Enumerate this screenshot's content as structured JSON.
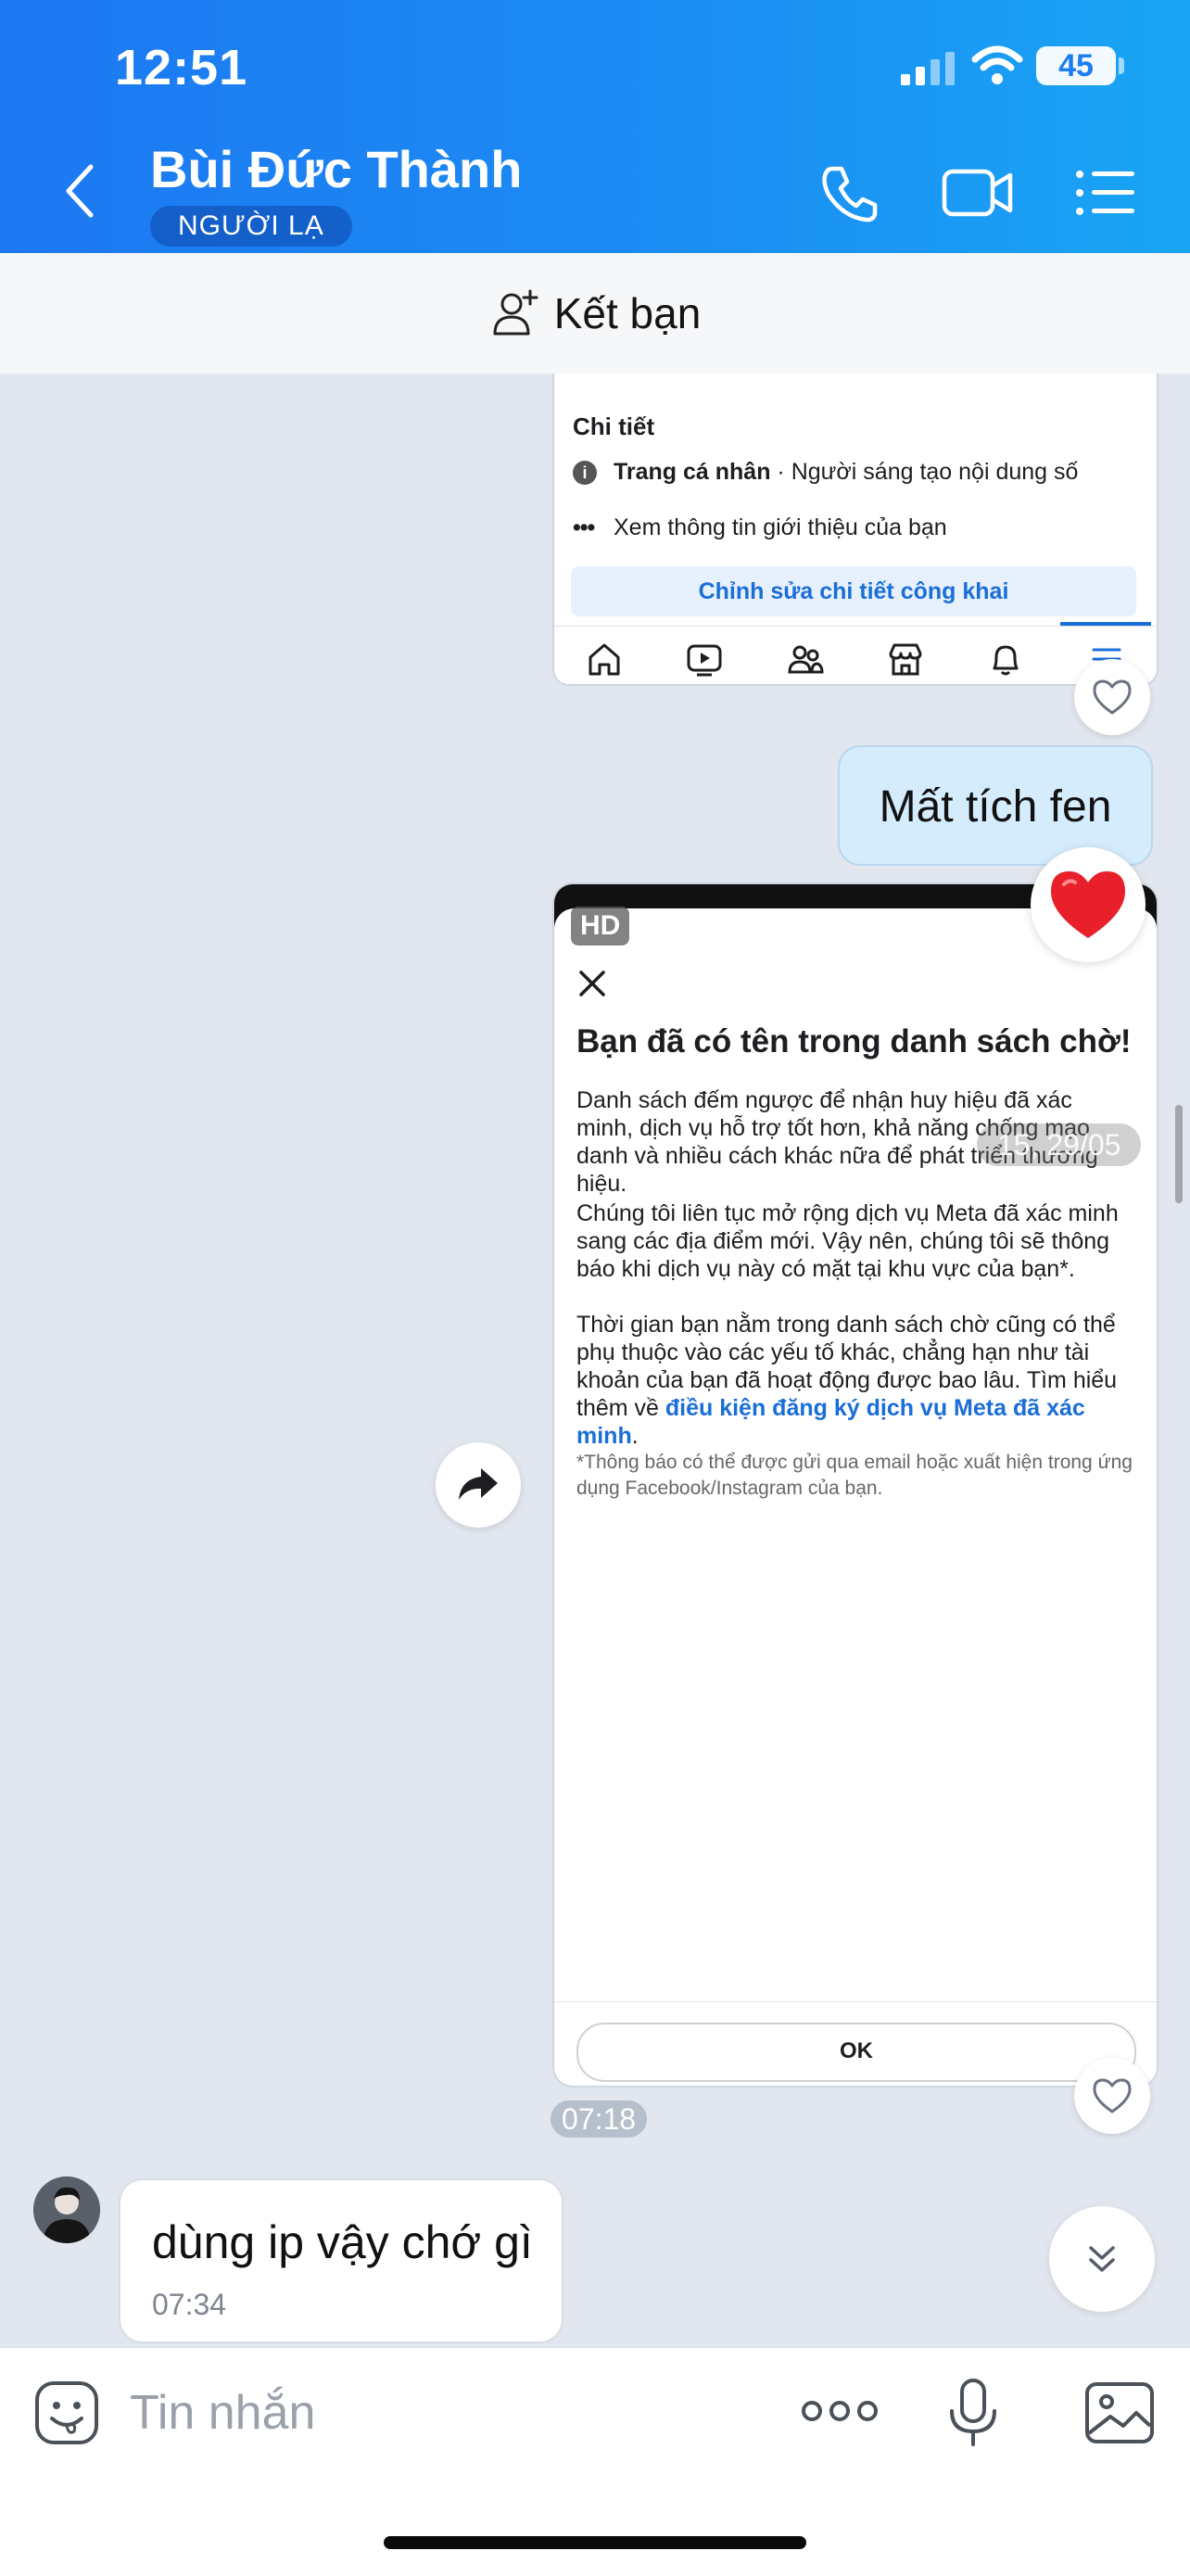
{
  "status_bar": {
    "time": "12:51",
    "battery": "45"
  },
  "header": {
    "contact_name": "Bùi Đức Thành",
    "badge": "NGƯỜI LẠ"
  },
  "add_friend": {
    "label": "Kết bạn"
  },
  "messages": {
    "image1": {
      "section_title": "Chi tiết",
      "profile_bold": "Trang cá nhân",
      "profile_rest": " · Người sáng tạo nội dung số",
      "see_intro": "Xem thông tin giới thiệu của bạn",
      "edit_button": "Chỉnh sửa chi tiết công khai"
    },
    "sent_text": "Mất tích fen",
    "image2": {
      "hd": "HD",
      "title": "Bạn đã có tên trong danh sách chờ!",
      "para1": "Danh sách đếm ngược để nhận huy hiệu đã xác minh, dịch vụ hỗ trợ tốt hơn, khả năng chống mạo danh và nhiều cách khác nữa để phát triển thương hiệu.",
      "para2": "Chúng tôi liên tục mở rộng dịch vụ Meta đã xác minh sang các địa điểm mới. Vậy nên, chúng tôi sẽ thông báo khi dịch vụ này có mặt tại khu vực của bạn*.",
      "para3_text": "Thời gian bạn nằm trong danh sách chờ cũng có thể phụ thuộc vào các yếu tố khác, chẳng hạn như tài khoản của bạn đã hoạt động được bao lâu. Tìm hiểu thêm về ",
      "para3_link": "điều kiện đăng ký dịch vụ Meta đã xác minh",
      "para3_end": ".",
      "footnote": "*Thông báo có thể được gửi qua email hoặc xuất hiện trong ứng dụng Facebook/Instagram của bạn.",
      "ok_label": "OK",
      "date_overlay": "15, 29/05"
    },
    "image2_time": "07:18",
    "received_text": "dùng ip vậy chớ gì",
    "received_time": "07:34"
  },
  "composer": {
    "placeholder": "Tin nhắn"
  },
  "colors": {
    "header_start": "#1d78f2",
    "header_end": "#19a5f4",
    "sent_bubble": "#d5ecfd",
    "link": "#1a6ed8"
  },
  "icons": [
    "back-icon",
    "phone-icon",
    "video-call-icon",
    "menu-icon",
    "add-friend-icon",
    "heart-icon",
    "forward-icon",
    "chevron-double-down-icon",
    "emoji-icon",
    "more-icon",
    "mic-icon",
    "gallery-icon"
  ]
}
